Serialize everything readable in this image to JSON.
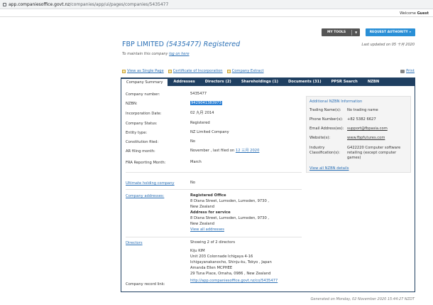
{
  "browser": {
    "url_host": "app.companiesoffice.govt.nz",
    "url_path": "/companies/app/ui/pages/companies/5435477"
  },
  "header": {
    "welcome_label": "Welcome",
    "welcome_user": "Guest"
  },
  "toolbar": {
    "mytools_label": "MY TOOLS",
    "request_label": "REQUEST AUTHORITY »"
  },
  "company": {
    "name": "FBP LIMITED",
    "number_paren": "(5435477)",
    "status_word": "Registered",
    "maintain_prefix": "To maintain this company",
    "maintain_link": "log on here",
    "updated": "Last updated on 05 十月 2020"
  },
  "links": {
    "single_page": "View as Single Page",
    "certificate": "Certificate of Incorporation",
    "extract": "Company Extract",
    "print": "Print"
  },
  "tabs": [
    {
      "label": "Company Summary"
    },
    {
      "label": "Addresses"
    },
    {
      "label": "Directors (2)"
    },
    {
      "label": "Shareholdings (1)"
    },
    {
      "label": "Documents (31)"
    },
    {
      "label": "PPSR Search"
    },
    {
      "label": "NZBN"
    }
  ],
  "summary": {
    "number_label": "Company number:",
    "number_value": "5435477",
    "nzbn_label": "NZBN:",
    "nzbn_value": "9429041383973",
    "incorp_label": "Incorporation Date:",
    "incorp_value": "02 九月 2014",
    "status_label": "Company Status:",
    "status_value": "Registered",
    "entity_label": "Entity type:",
    "entity_value": "NZ Limited Company",
    "constitution_label": "Constitution filed:",
    "constitution_value": "No",
    "ar_label": "AR filing month:",
    "ar_value_prefix": "November , last filed on",
    "ar_value_link": "12 三月 2020",
    "fra_label": "FRA Reporting Month:",
    "fra_value": "March",
    "uhc_label": "Ultimate holding company",
    "uhc_value": "No",
    "addresses_label": "Company addresses:",
    "reg_office_title": "Registered Office",
    "reg_office_line1": "8 Diana Street, Lumsden, Lumsden, 9730 ,",
    "reg_office_line2": "New Zealand",
    "service_title": "Address for service",
    "service_line1": "8 Diana Street, Lumsden, Lumsden, 9730 ,",
    "service_line2": "New Zealand",
    "view_all_addresses": "View all addresses",
    "directors_label": "Directors",
    "directors_showing": "Showing 2 of 2 directors",
    "director1_name": "Kiju KIM",
    "director1_line1": "Unit 203 Colonnade Ichigaya 4-16",
    "director1_line2": "Ichigayanakanocho, Shinju-ku, Tokyo , Japan",
    "director2_name": "Amanda Ellen MCPHEE",
    "director2_line1": "29 Tuna Place, Omaha, 0986 , New Zealand",
    "record_label": "Company record link:",
    "record_value": "http://app.companiesoffice.govt.nz/co/5435477"
  },
  "nzbn_info": {
    "heading": "Additional NZBN Information",
    "trading_label": "Trading Name(s):",
    "trading_value": "No trading name",
    "phone_label": "Phone Number(s):",
    "phone_value": "+82 5382 6627",
    "email_label": "Email Address(es):",
    "email_value": "support@fbpasia.com",
    "website_label": "Website(s):",
    "website_value": "www.fbpfutures.com",
    "industry_label1": "Industry",
    "industry_label2": "Classification(s):",
    "industry_value": "G422220 Computer software retailing (except computer games)",
    "view_all": "View all NZBN details"
  },
  "footer": {
    "generated": "Generated on Monday, 02 November 2020 15:44:27 NZDT"
  }
}
